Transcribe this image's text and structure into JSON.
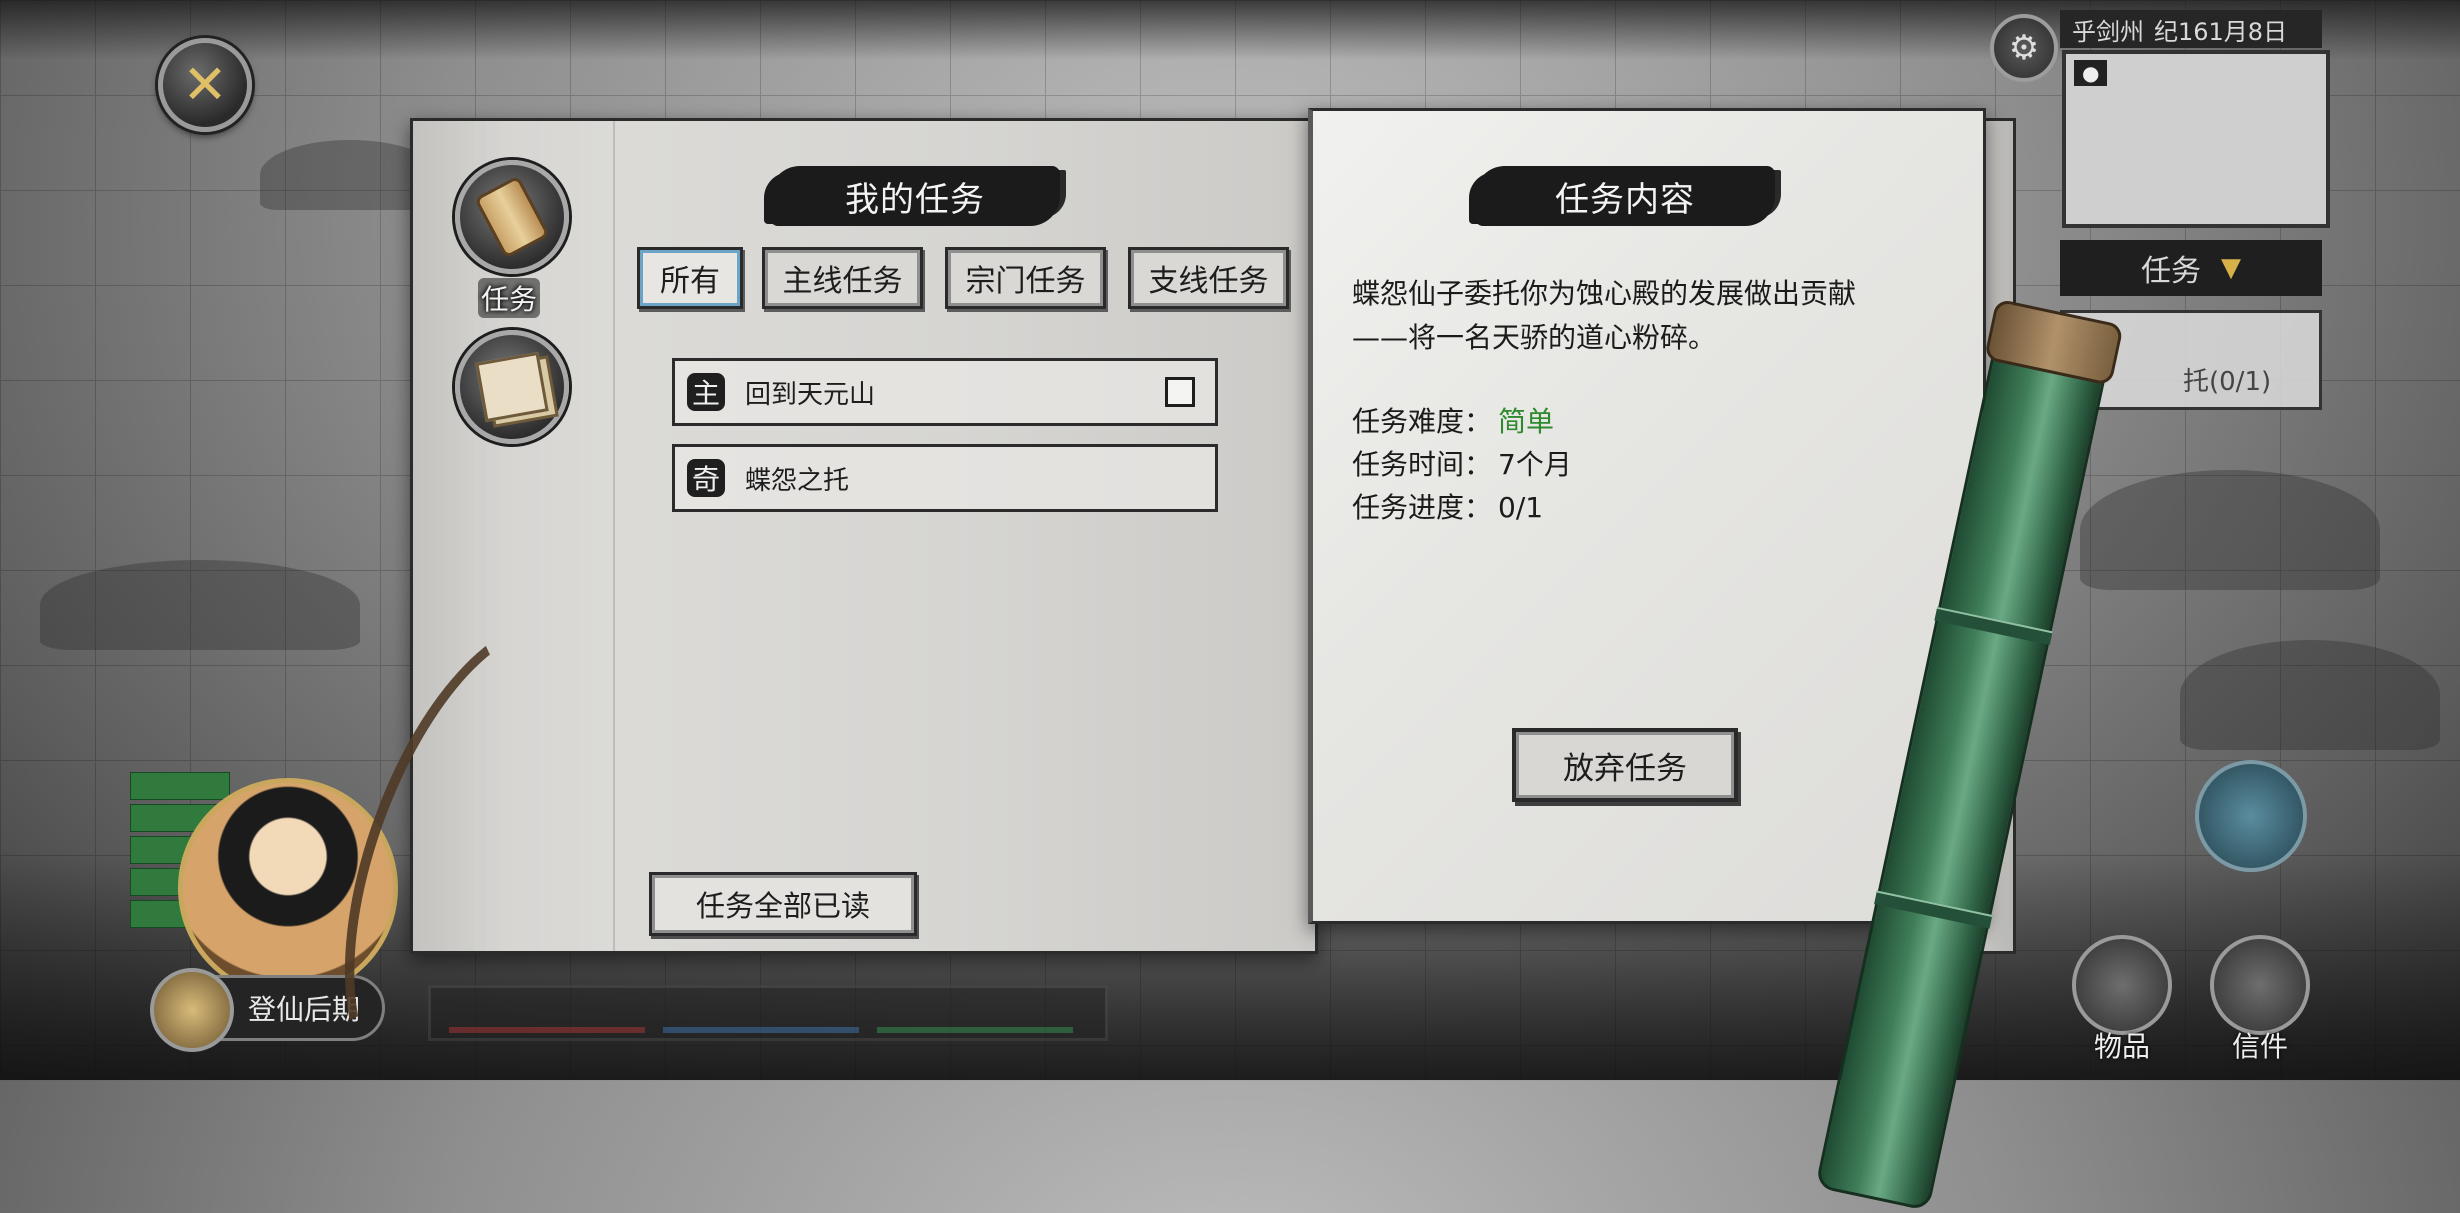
{
  "close_button": {
    "icon": "close-icon",
    "glyph": "✕",
    "color": "#e0c066"
  },
  "side_nav": {
    "quests_label": "任务",
    "quests_icon": "scroll-icon",
    "letters_icon": "letters-icon"
  },
  "left_page": {
    "title": "我的任务",
    "tabs": [
      {
        "label": "所有",
        "active": true
      },
      {
        "label": "主线任务",
        "active": false
      },
      {
        "label": "宗门任务",
        "active": false
      },
      {
        "label": "支线任务",
        "active": false
      }
    ],
    "quests": [
      {
        "badge": "主",
        "name": "回到天元山",
        "checkbox": true
      },
      {
        "badge": "奇",
        "name": "蝶怨之托",
        "checkbox": false
      }
    ],
    "read_all_label": "任务全部已读"
  },
  "right_page": {
    "title": "任务内容",
    "description": "蝶怨仙子委托你为蚀心殿的发展做出贡献\n——将一名天骄的道心粉碎。",
    "difficulty_label": "任务难度：",
    "difficulty_value": "简单",
    "difficulty_color": "#2e8a2e",
    "time_label": "任务时间：",
    "time_value": "7个月",
    "progress_label": "任务进度：",
    "progress_value": "0/1",
    "abandon_label": "放弃任务"
  },
  "hud": {
    "settings_icon": "gear-icon",
    "location": "乎剑州",
    "date": "纪161月8日",
    "task_dropdown_label": "任务",
    "task_mini_text": "托(0/1)",
    "realm_label": "登仙后期",
    "status_tags": [
      "",
      ""
    ],
    "bottom_buttons": [
      "物品",
      "信件"
    ]
  }
}
